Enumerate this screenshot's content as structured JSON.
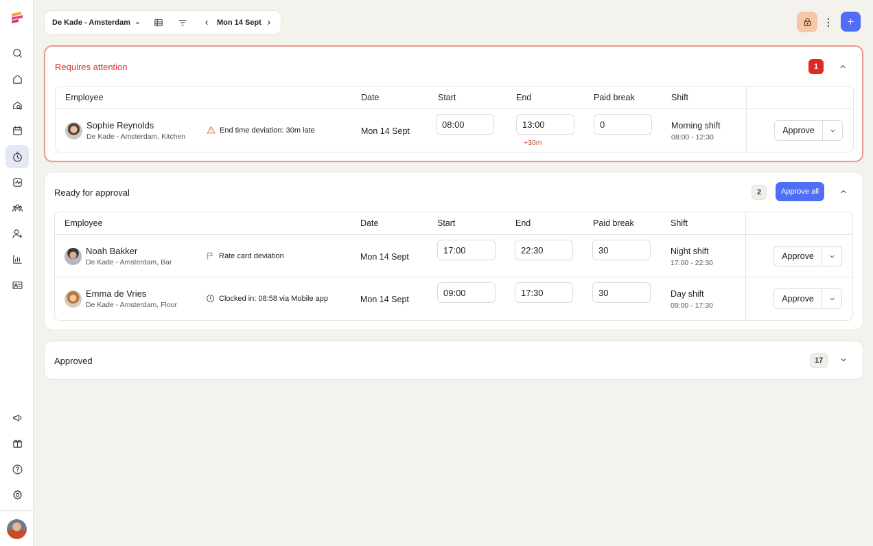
{
  "colors": {
    "accent": "#4f6ef5",
    "danger": "#df2a24",
    "attention_border": "#ea9a94",
    "lock_bg": "#f6c6a6"
  },
  "sidebar": {
    "icons": [
      "search-icon",
      "home-icon",
      "search-location-icon",
      "calendar-icon",
      "timer-icon",
      "activity-icon",
      "team-icon",
      "add-user-icon",
      "chart-icon",
      "id-card-icon",
      "megaphone-icon",
      "gift-icon",
      "help-icon",
      "settings-icon"
    ],
    "active": "timer-icon"
  },
  "toolbar": {
    "location": "De Kade - Amsterdam",
    "date": "Mon 14 Sept"
  },
  "columns": {
    "employee": "Employee",
    "date": "Date",
    "start": "Start",
    "end": "End",
    "paid_break": "Paid break",
    "shift": "Shift"
  },
  "attention": {
    "title": "Requires attention",
    "count": "1",
    "rows": [
      {
        "name": "Sophie Reynolds",
        "sub": "De Kade - Amsterdam, Kitchen",
        "note": "End time deviation: 30m late",
        "date": "Mon 14 Sept",
        "start": "08:00",
        "end": "13:00",
        "end_delta": "+30m",
        "paid_break": "0",
        "shift_name": "Morning shift",
        "shift_time": "08:00 - 12:30",
        "action": "Approve"
      }
    ]
  },
  "ready": {
    "title": "Ready for approval",
    "count": "2",
    "approve_all": "Approve all",
    "rows": [
      {
        "name": "Noah Bakker",
        "sub": "De Kade - Amsterdam, Bar",
        "note": "Rate card deviation",
        "date": "Mon 14 Sept",
        "start": "17:00",
        "end": "22:30",
        "paid_break": "30",
        "shift_name": "Night shift",
        "shift_time": "17:00 - 22:30",
        "action": "Approve"
      },
      {
        "name": "Emma de Vries",
        "sub": "De Kade - Amsterdam, Floor",
        "note": "Clocked in: 08:58 via Mobile app",
        "date": "Mon 14 Sept",
        "start": "09:00",
        "end": "17:30",
        "paid_break": "30",
        "shift_name": "Day shift",
        "shift_time": "09:00 - 17:30",
        "action": "Approve"
      }
    ]
  },
  "approved": {
    "title": "Approved",
    "count": "17"
  }
}
